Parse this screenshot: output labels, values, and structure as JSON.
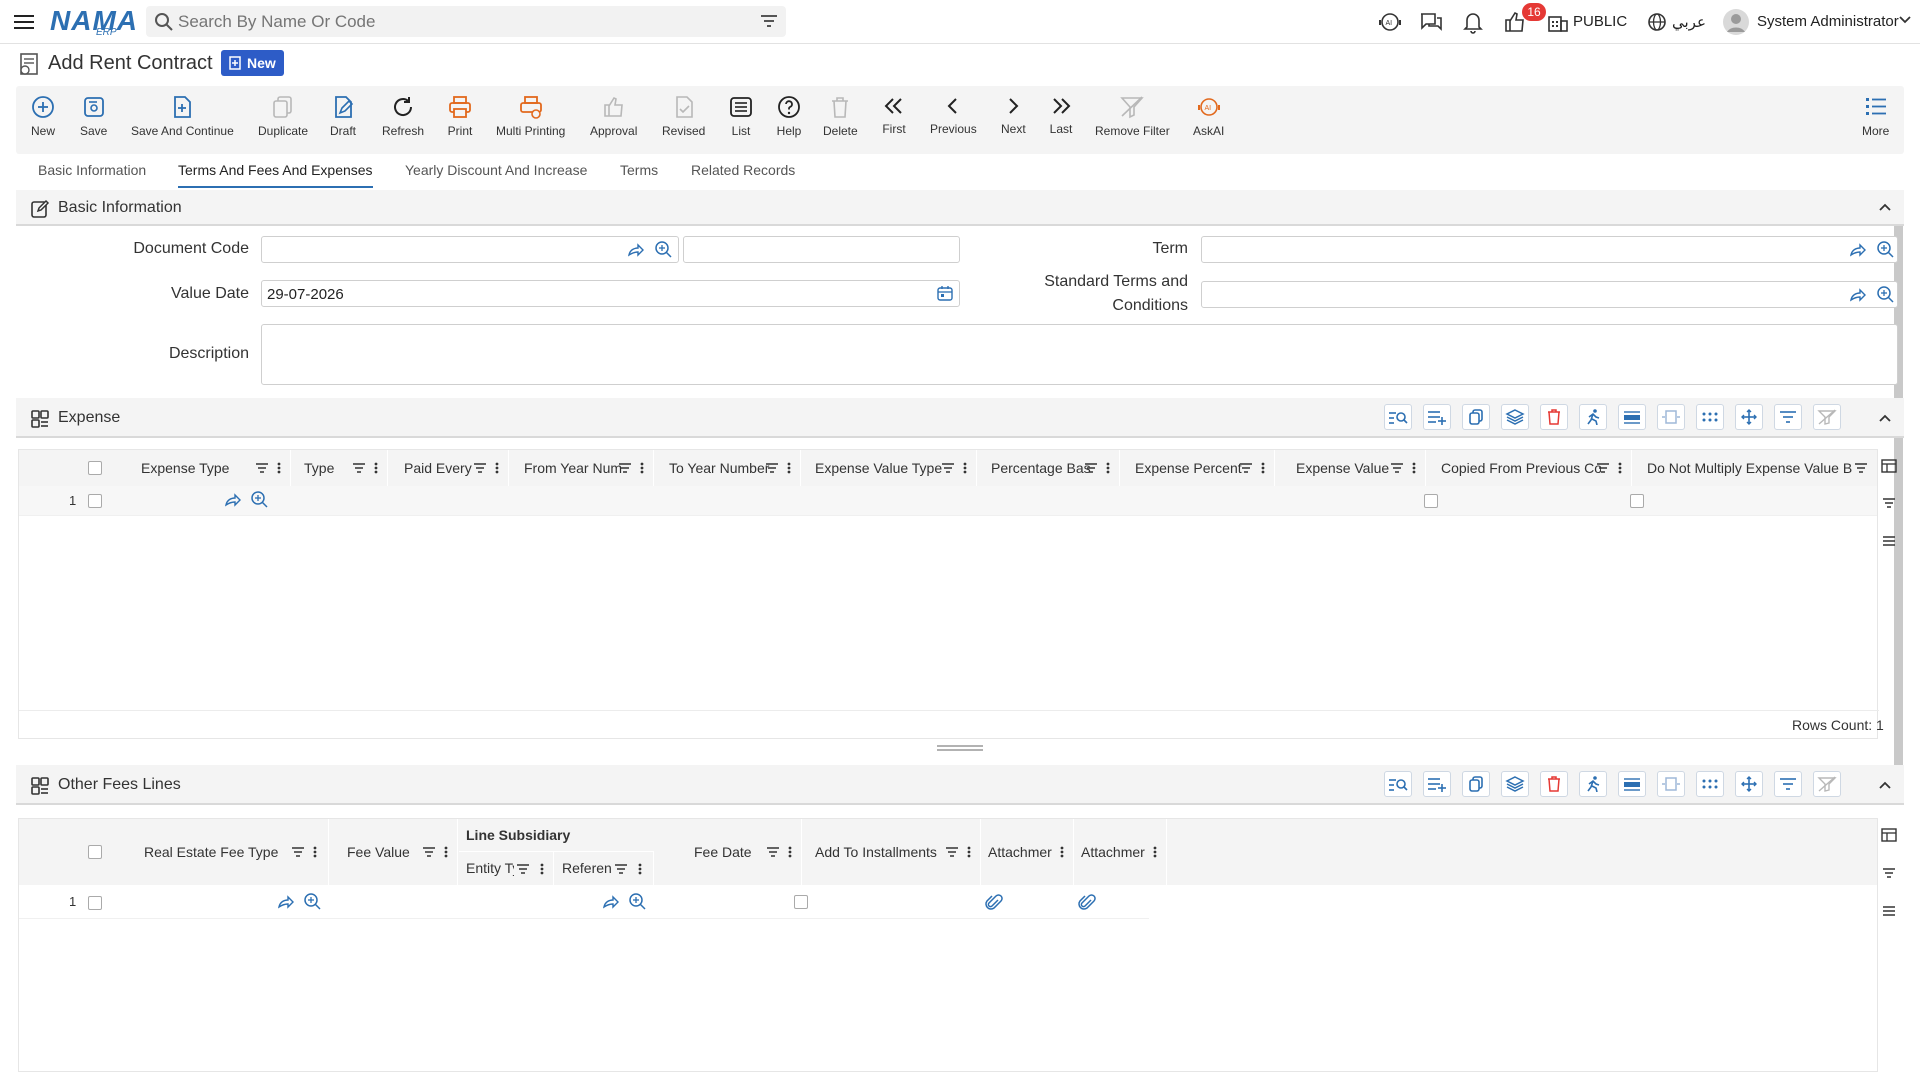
{
  "app": {
    "logo_text": "NAMA",
    "logo_sub": "ERP",
    "search_placeholder": "Search By Name Or Code",
    "notifications_count": "16",
    "branch_label": "PUBLIC",
    "language_label": "عربي",
    "user_name": "System Administrator"
  },
  "page": {
    "title": "Add Rent Contract",
    "status_badge": "New"
  },
  "toolbar": {
    "items": [
      {
        "label": "New",
        "icon": "plus-circle-icon"
      },
      {
        "label": "Save",
        "icon": "save-icon"
      },
      {
        "label": "Save And Continue",
        "icon": "save-continue-icon"
      },
      {
        "label": "Duplicate",
        "icon": "duplicate-icon"
      },
      {
        "label": "Draft",
        "icon": "draft-icon"
      },
      {
        "label": "Refresh",
        "icon": "refresh-icon"
      },
      {
        "label": "Print",
        "icon": "print-icon"
      },
      {
        "label": "Multi Printing",
        "icon": "multi-print-icon"
      },
      {
        "label": "Approval",
        "icon": "approval-icon"
      },
      {
        "label": "Revised",
        "icon": "revised-icon"
      },
      {
        "label": "List",
        "icon": "list-icon"
      },
      {
        "label": "Help",
        "icon": "help-icon"
      },
      {
        "label": "Delete",
        "icon": "delete-icon"
      },
      {
        "label": "First",
        "icon": "first-icon"
      },
      {
        "label": "Previous",
        "icon": "previous-icon"
      },
      {
        "label": "Next",
        "icon": "next-icon"
      },
      {
        "label": "Last",
        "icon": "last-icon"
      },
      {
        "label": "Remove Filter",
        "icon": "remove-filter-icon"
      },
      {
        "label": "AskAI",
        "icon": "ai-icon"
      },
      {
        "label": "More",
        "icon": "more-icon"
      }
    ]
  },
  "tabs": [
    {
      "label": "Basic Information",
      "active": false
    },
    {
      "label": "Terms And Fees And Expenses",
      "active": true
    },
    {
      "label": "Yearly Discount And Increase",
      "active": false
    },
    {
      "label": "Terms",
      "active": false
    },
    {
      "label": "Related Records",
      "active": false
    }
  ],
  "basic_info": {
    "title": "Basic Information",
    "document_code_label": "Document Code",
    "document_code_value": "",
    "document_code_name": "",
    "term_label": "Term",
    "term_value": "",
    "value_date_label": "Value Date",
    "value_date_value": "29-07-2026",
    "standard_terms_label_1": "Standard Terms and",
    "standard_terms_label_2": "Conditions",
    "standard_terms_value": "",
    "description_label": "Description",
    "description_value": ""
  },
  "expense": {
    "title": "Expense",
    "columns": [
      "Expense Type",
      "Type",
      "Paid Every",
      "From Year Num",
      "To Year Number",
      "Expense Value Type",
      "Percentage Bas",
      "Expense Percent",
      "Expense Value",
      "Copied From Previous Co",
      "Do Not Multiply Expense Value By P"
    ],
    "rows": [
      {
        "num": "1"
      }
    ],
    "rows_count": "Rows Count: 1"
  },
  "other_fees": {
    "title": "Other Fees Lines",
    "group_header": "Line Subsidiary",
    "columns": [
      "Real Estate Fee Type",
      "Fee Value",
      "Entity Ty",
      "Referen",
      "Fee Date",
      "Add To Installments",
      "Attachmer",
      "Attachmer"
    ],
    "rows": [
      {
        "num": "1"
      }
    ]
  },
  "colors": {
    "accent": "#2c6fb2",
    "badge": "#2d5cc7",
    "print_orange": "#e2691d",
    "notification_red": "#e53935"
  }
}
